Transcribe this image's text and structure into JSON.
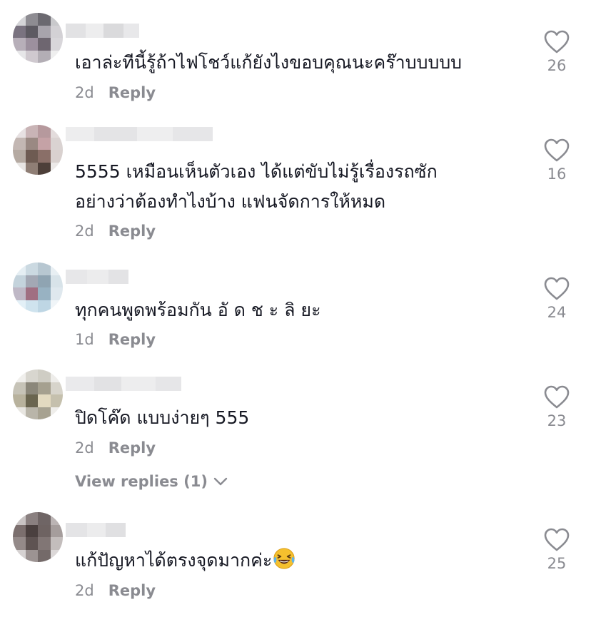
{
  "comments": [
    {
      "text": "เอาล่ะทีนี้รู้ถ้าไฟโชว์แก้ยังไงขอบคุณนะคร๊าบบบบบ",
      "time": "2d",
      "reply_label": "Reply",
      "likes": "26"
    },
    {
      "text": "5555 เหมือนเห็นตัวเอง ได้แต่ขับไม่รู้เรื่องรถซัก\nอย่างว่าต้องทำไงบ้าง แฟนจัดการให้หมด",
      "time": "2d",
      "reply_label": "Reply",
      "likes": "16"
    },
    {
      "text": "ทุกคนพูดพร้อมกัน อั ด ช ะ ลิ ยะ",
      "time": "1d",
      "reply_label": "Reply",
      "likes": "24"
    },
    {
      "text": "ปิดโค๊ด แบบง่ายๆ 555",
      "time": "2d",
      "reply_label": "Reply",
      "likes": "23",
      "view_replies": "View replies (1)"
    },
    {
      "text": "แก้ปัญหาได้ตรงจุดมากค่ะ",
      "emoji": "grinning-squinting-tears-emoji",
      "time": "2d",
      "reply_label": "Reply",
      "likes": "25"
    }
  ],
  "colors": {
    "text": "#161823",
    "meta": "#8a8b91",
    "icon": "#8a8b91"
  }
}
